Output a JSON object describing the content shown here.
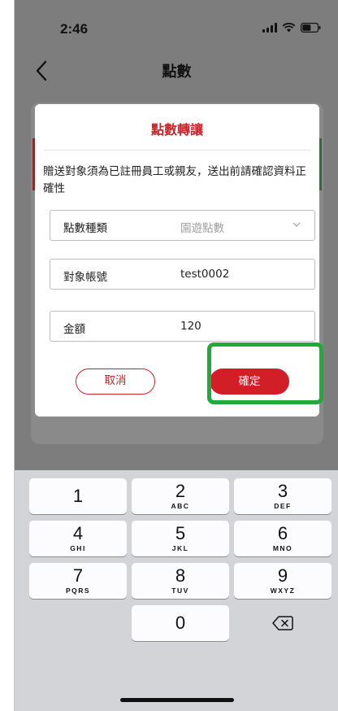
{
  "status_bar": {
    "time": "2:46"
  },
  "nav": {
    "title": "點數"
  },
  "dialog": {
    "title": "點數轉讓",
    "note": "贈送對象須為已註冊員工或親友，送出前請確認資料正確性",
    "fields": [
      {
        "label": "點數種類",
        "value": "園遊點數"
      },
      {
        "label": "對象帳號",
        "value": "test0002"
      },
      {
        "label": "金額",
        "value": "120"
      }
    ],
    "cancel_label": "取消",
    "confirm_label": "確定"
  },
  "keypad": {
    "keys": [
      {
        "digit": "1",
        "letters": ""
      },
      {
        "digit": "2",
        "letters": "ABC"
      },
      {
        "digit": "3",
        "letters": "DEF"
      },
      {
        "digit": "4",
        "letters": "GHI"
      },
      {
        "digit": "5",
        "letters": "JKL"
      },
      {
        "digit": "6",
        "letters": "MNO"
      },
      {
        "digit": "7",
        "letters": "PQRS"
      },
      {
        "digit": "8",
        "letters": "TUV"
      },
      {
        "digit": "9",
        "letters": "WXYZ"
      },
      {
        "digit": "0",
        "letters": ""
      }
    ]
  },
  "colors": {
    "accent_red": "#d21f27",
    "highlight_green": "#1faa3b"
  }
}
